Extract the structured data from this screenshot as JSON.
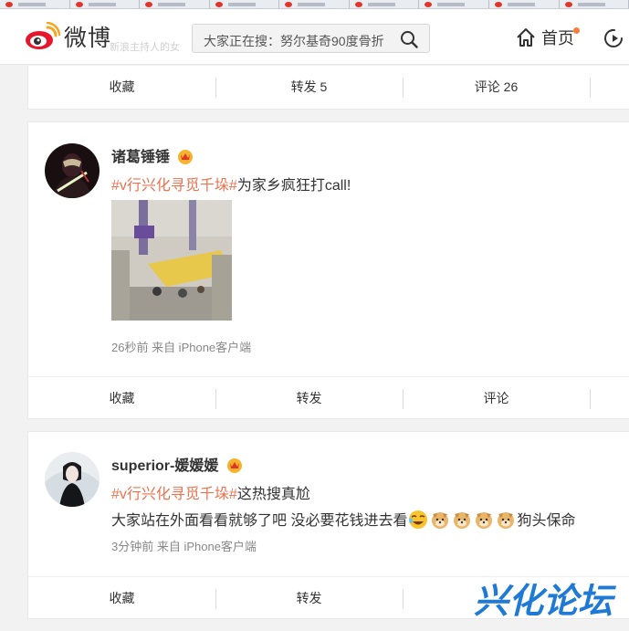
{
  "header": {
    "logo_text": "微博",
    "faint_text": "新浪主持人的女",
    "search_placeholder": "大家正在搜：努尔基奇90度骨折",
    "nav_home": "首页"
  },
  "card_top": {
    "actions": [
      "收藏",
      "转发 5",
      "评论 26"
    ]
  },
  "post1": {
    "user": "诸葛锤锤",
    "topic": "#v行兴化寻觅千垛#",
    "text": "为家乡疯狂打call!",
    "meta": "26秒前 来自 iPhone客户端",
    "actions": [
      "收藏",
      "转发",
      "评论"
    ]
  },
  "post2": {
    "user": "superior-媛媛媛",
    "topic": "#v行兴化寻觅千垛#",
    "text": "这热搜真尬",
    "line2": "大家站在外面看看就够了吧 没必要花钱进去看",
    "line2_suffix": "狗头保命",
    "meta": "3分钟前 来自 iPhone客户端",
    "actions": [
      "收藏",
      "转发"
    ]
  },
  "watermark": "兴化论坛",
  "colors": {
    "accent": "#eb7350",
    "brand_red": "#e6162d",
    "watermark_blue": "#1f7ad6"
  }
}
